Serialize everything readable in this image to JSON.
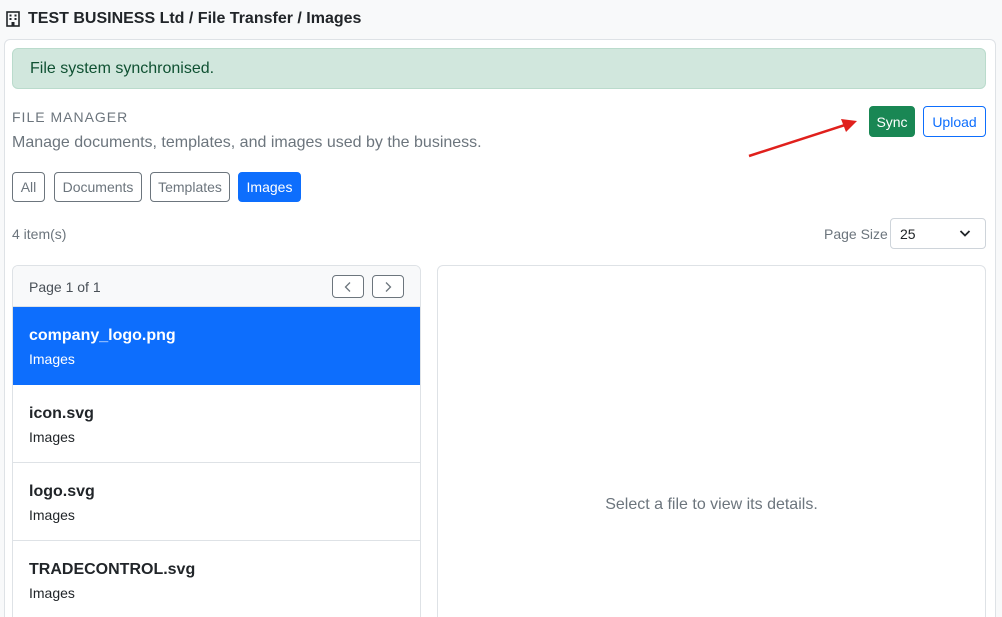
{
  "breadcrumb": {
    "text": "TEST BUSINESS Ltd / File Transfer / Images",
    "icon": "building-icon"
  },
  "alert": {
    "text": "File system synchronised.",
    "color": "#d1e7dd"
  },
  "section": {
    "title": "FILE MANAGER",
    "description": "Manage documents, templates, and images used by the business."
  },
  "actions": {
    "sync_label": "Sync",
    "upload_label": "Upload",
    "sync_color": "#198754",
    "upload_color": "#0d6efd"
  },
  "filters": [
    {
      "label": "All",
      "active": false
    },
    {
      "label": "Documents",
      "active": false
    },
    {
      "label": "Templates",
      "active": false
    },
    {
      "label": "Images",
      "active": true
    }
  ],
  "toolbar": {
    "items_count": "4 item(s)",
    "page_size_label": "Page Size",
    "page_size_value": "25"
  },
  "list": {
    "page_label": "Page 1 of 1",
    "files": [
      {
        "name": "company_logo.png",
        "category": "Images",
        "selected": true
      },
      {
        "name": "icon.svg",
        "category": "Images",
        "selected": false
      },
      {
        "name": "logo.svg",
        "category": "Images",
        "selected": false
      },
      {
        "name": "TRADECONTROL.svg",
        "category": "Images",
        "selected": false
      }
    ]
  },
  "detail": {
    "placeholder": "Select a file to view its details."
  },
  "annotation": {
    "arrow_color": "#e0201c"
  }
}
